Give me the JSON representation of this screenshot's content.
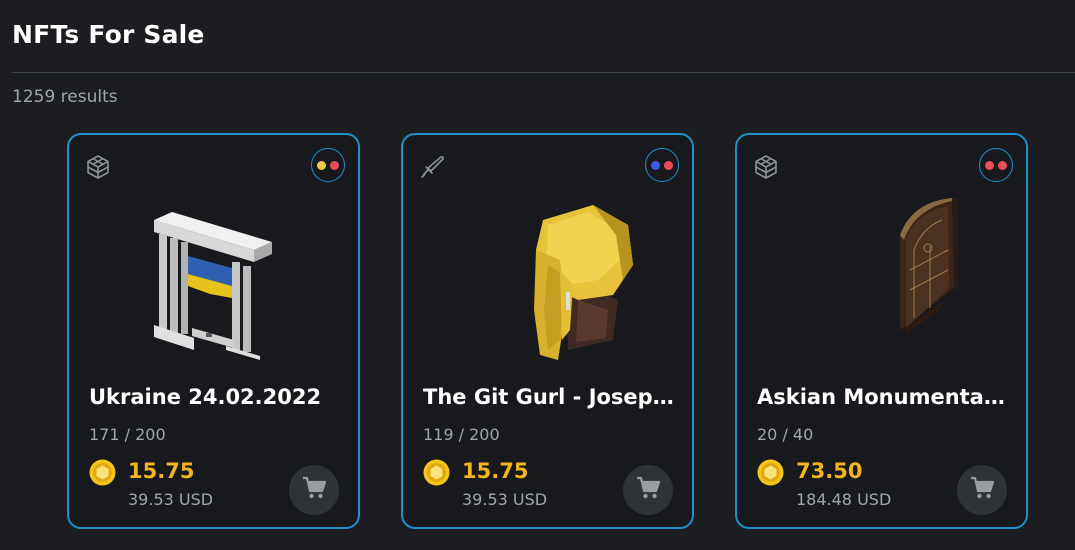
{
  "header": {
    "title": "NFTs For Sale",
    "results": "1259 results"
  },
  "cards": [
    {
      "type_icon": "cube-icon",
      "dots": [
        "#f2c94c",
        "#eb4d5c"
      ],
      "name": "Ukraine 24.02.2022",
      "supply": "171 / 200",
      "price": "15.75",
      "usd": "39.53 USD"
    },
    {
      "type_icon": "sword-icon",
      "dots": [
        "#3d5ae8",
        "#eb4d5c"
      ],
      "name": "The Git Gurl - Josep...",
      "supply": "119 / 200",
      "price": "15.75",
      "usd": "39.53 USD"
    },
    {
      "type_icon": "cube-icon",
      "dots": [
        "#eb4d5c",
        "#eb4d5c"
      ],
      "name": "Askian Monumental ...",
      "supply": "20 / 40",
      "price": "73.50",
      "usd": "184.48 USD"
    }
  ],
  "colors": {
    "accent": "#1f8fce",
    "price": "#f2b521",
    "background": "#1b1d20"
  }
}
